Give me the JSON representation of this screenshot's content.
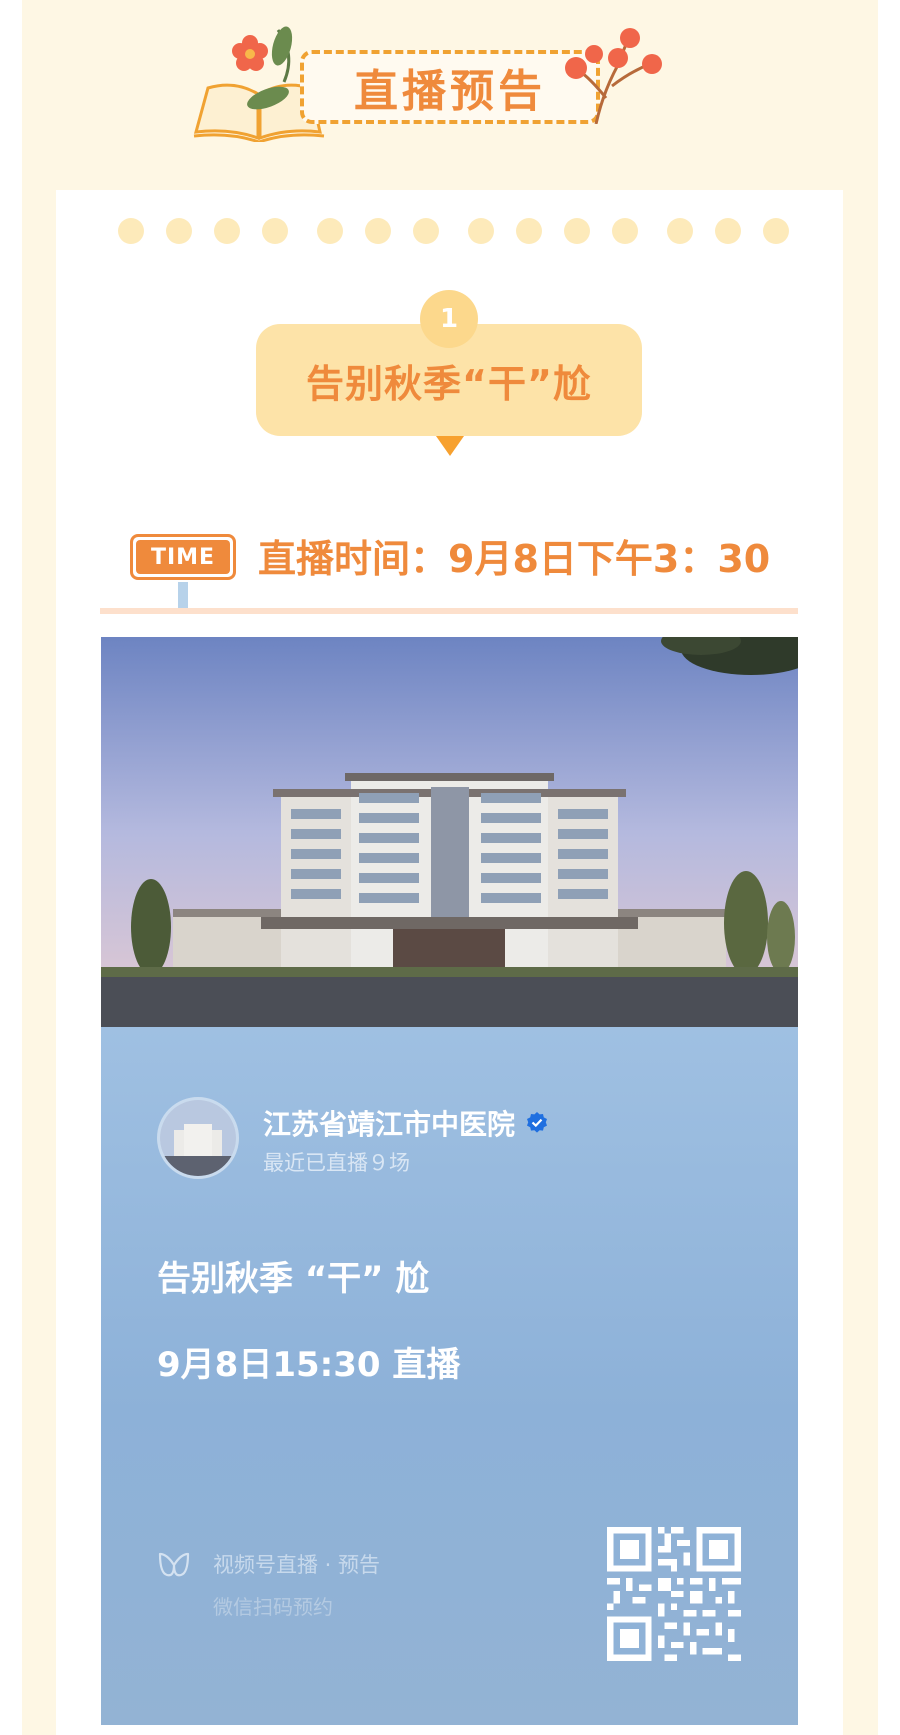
{
  "header": {
    "title": "直播预告"
  },
  "section": {
    "number": "1",
    "title": "告别秋季“干”尬"
  },
  "schedule": {
    "badge": "TIME",
    "text": "直播时间：9月8日下午3：30"
  },
  "poster": {
    "org_name": "江苏省靖江市中医院",
    "org_sub": "最近已直播９场",
    "title": "告别秋季 “干” 尬",
    "time": "9月8日15:30 直播",
    "channel_label": "视频号直播 · 预告",
    "channel_sub": "微信扫码预约"
  },
  "colors": {
    "accent": "#ef8a3c",
    "page_bg": "#fef7e4",
    "pill_bg": "#fde3a8",
    "poster_bg": "#9fc0e2"
  },
  "icons": [
    "book-icon",
    "flower-icon",
    "verified-icon",
    "channels-icon",
    "qr-code"
  ]
}
